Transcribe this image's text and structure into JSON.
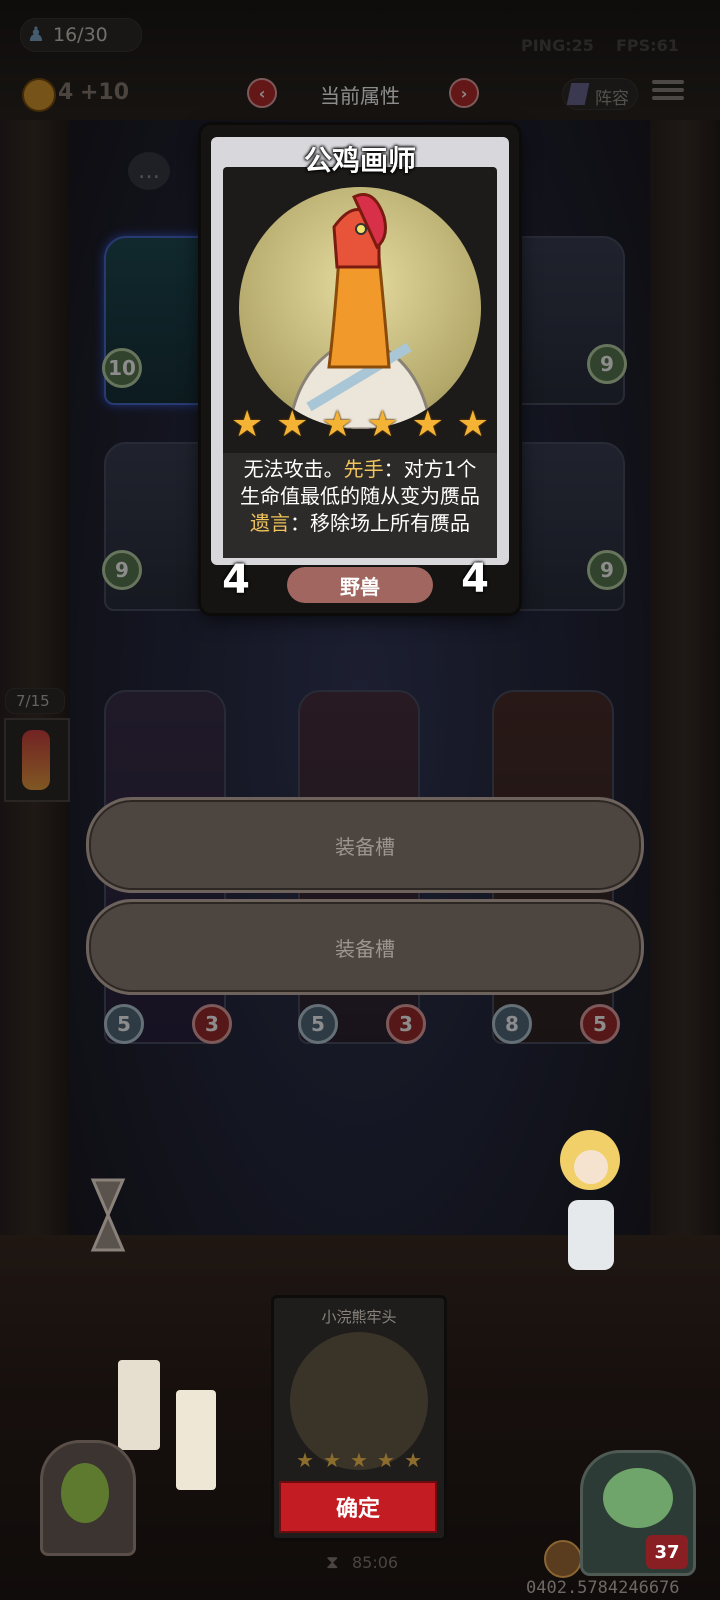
{
  "hud": {
    "squad_count": "16/30",
    "ping": "PING:25",
    "fps": "FPS:61",
    "gold": "4",
    "gold_income": "+10",
    "lineup_label": "阵容",
    "side_counter": "7/15"
  },
  "nav": {
    "title": "当前属性",
    "prev_icon": "‹",
    "next_icon": "›"
  },
  "card": {
    "name": "公鸡画师",
    "stars": [
      "★",
      "★",
      "★",
      "★",
      "★",
      "★"
    ],
    "line1_a": "无法攻击。",
    "line1_kw": "先手",
    "line1_b": "：对方1个",
    "line2": "生命值最低的随从变为赝品",
    "line3_kw": "遗言",
    "line3_b": "：移除场上所有赝品",
    "attack": "4",
    "health": "4",
    "tribe": "野兽"
  },
  "board": {
    "top_left": {
      "level": "10"
    },
    "top_right": {
      "level": "9"
    },
    "mid_left": {
      "level": "9"
    },
    "mid_right": {
      "level": "9"
    },
    "bottom": [
      {
        "attack": "5",
        "health": "3"
      },
      {
        "attack": "5",
        "health": "3"
      },
      {
        "attack": "8",
        "health": "5"
      }
    ]
  },
  "equip_slots": [
    "装备槽",
    "装备槽"
  ],
  "offer": {
    "name": "小浣熊牢头",
    "stars": [
      "★",
      "★",
      "★",
      "★",
      "★"
    ],
    "confirm_label": "确定"
  },
  "footer": {
    "timer": "85:06",
    "player_hp": "37",
    "id_code": "0402.5784246676"
  },
  "colors": {
    "accent_red": "#c31c22",
    "star": "#f4b335",
    "keyword": "#f0c45a"
  }
}
